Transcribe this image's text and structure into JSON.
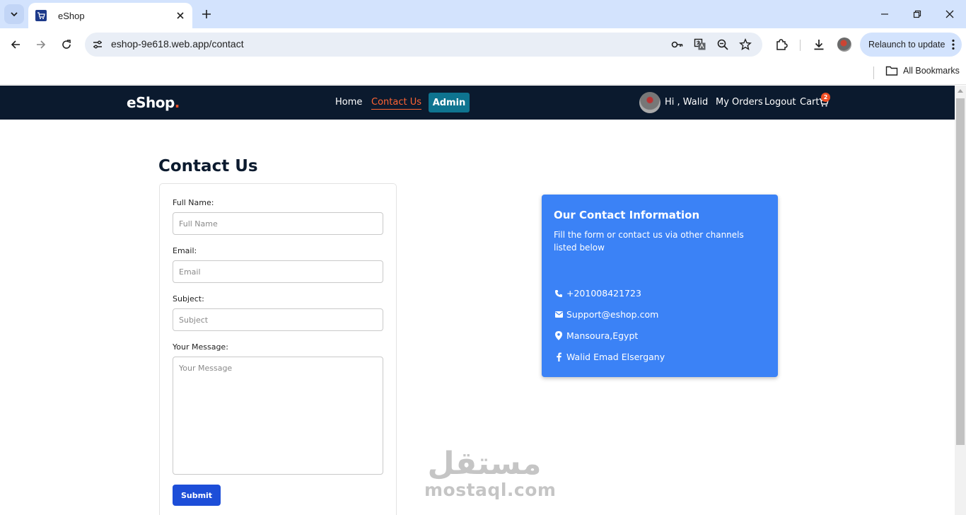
{
  "browser": {
    "tab_title": "eShop",
    "url": "eshop-9e618.web.app/contact",
    "relaunch_label": "Relaunch to update",
    "bookmarks_label": "All Bookmarks"
  },
  "site": {
    "logo_main": "eShop",
    "logo_accent": ".",
    "nav": {
      "home": "Home",
      "contact": "Contact Us",
      "admin": "Admin"
    },
    "user": {
      "greeting": "Hi , Walid",
      "orders": "My Orders",
      "logout": "Logout",
      "cart": "Cart",
      "cart_count": "2"
    }
  },
  "page": {
    "title": "Contact Us",
    "form": {
      "full_name_label": "Full Name:",
      "full_name_placeholder": "Full Name",
      "email_label": "Email:",
      "email_placeholder": "Email",
      "subject_label": "Subject:",
      "subject_placeholder": "Subject",
      "message_label": "Your Message:",
      "message_placeholder": "Your Message",
      "submit_label": "Submit"
    },
    "contact_info": {
      "title": "Our Contact Information",
      "subtitle": "Fill the form or contact us via other channels listed below",
      "phone": "+201008421723",
      "email": "Support@eshop.com",
      "location": "Mansoura,Egypt",
      "facebook": "Walid Emad Elsergany"
    },
    "watermark": {
      "arabic": "مستقل",
      "latin": "mostaql.com"
    }
  },
  "colors": {
    "header_bg": "#0b1a2e",
    "accent_orange": "#f04e23",
    "admin_teal": "#0e7490",
    "submit_blue": "#1d4ed8",
    "info_blue": "#3b82f6"
  },
  "icons": [
    "search-tabs-icon",
    "favicon-cart-icon",
    "close-icon",
    "plus-icon",
    "minimize-icon",
    "restore-icon",
    "back-icon",
    "forward-icon",
    "reload-icon",
    "site-info-icon",
    "key-icon",
    "translate-icon",
    "zoom-icon",
    "star-icon",
    "extensions-icon",
    "download-icon",
    "folder-icon",
    "cart-icon",
    "phone-icon",
    "mail-icon",
    "location-icon",
    "facebook-icon"
  ]
}
